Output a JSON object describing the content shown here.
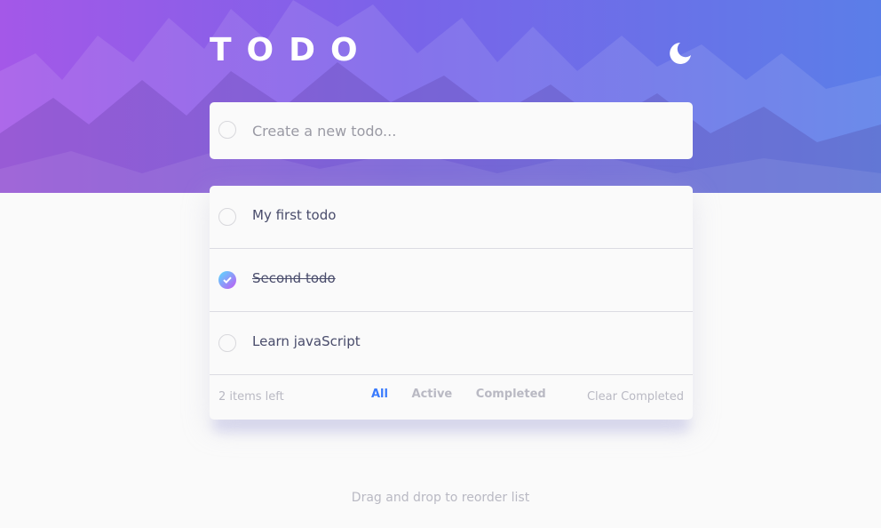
{
  "header": {
    "title": "TODO",
    "theme_icon": "moon-icon"
  },
  "new_todo": {
    "placeholder": "Create a new todo...",
    "value": ""
  },
  "todos": [
    {
      "text": "My first todo",
      "completed": false
    },
    {
      "text": "Second todo",
      "completed": true
    },
    {
      "text": "Learn javaScript",
      "completed": false
    }
  ],
  "footer": {
    "items_left": "2 items left",
    "filters": [
      "All",
      "Active",
      "Completed"
    ],
    "active_filter": "All",
    "clear_label": "Clear Completed"
  },
  "hint": "Drag and drop to reorder list",
  "colors": {
    "accent": "#3a7bfd",
    "check_gradient_start": "#57ddff",
    "check_gradient_end": "#c058f3",
    "hero_start": "#a458e8",
    "hero_end": "#5b7ee8"
  }
}
